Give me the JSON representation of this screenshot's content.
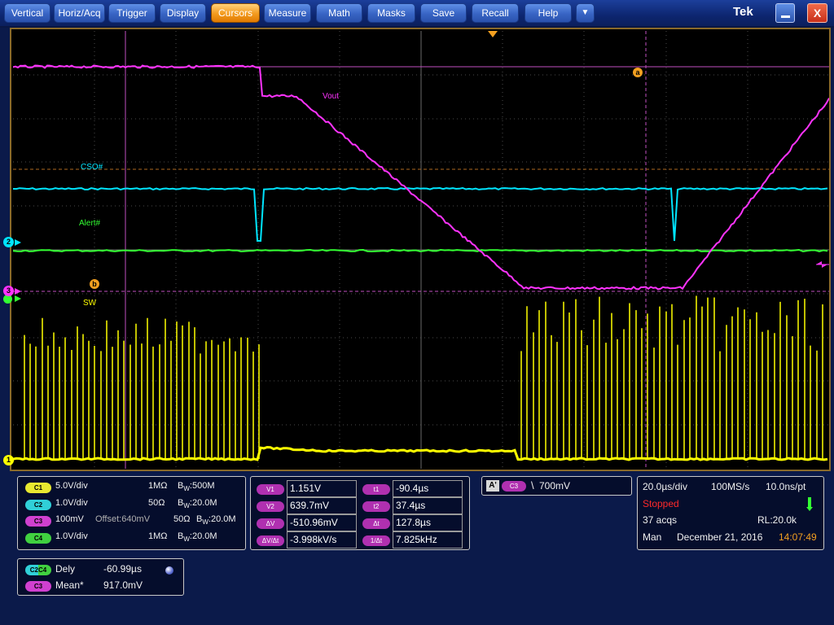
{
  "menu": {
    "items": [
      {
        "label": "Vertical",
        "active": false
      },
      {
        "label": "Horiz/Acq",
        "active": false
      },
      {
        "label": "Trigger",
        "active": false
      },
      {
        "label": "Display",
        "active": false
      },
      {
        "label": "Cursors",
        "active": true
      },
      {
        "label": "Measure",
        "active": false
      },
      {
        "label": "Math",
        "active": false
      },
      {
        "label": "Masks",
        "active": false
      },
      {
        "label": "Save",
        "active": false
      },
      {
        "label": "Recall",
        "active": false
      },
      {
        "label": "Help",
        "active": false
      }
    ],
    "more_glyph": "▼",
    "brand": "Tek",
    "minimize_glyph": "_",
    "close_glyph": "X"
  },
  "scope": {
    "trace_labels": {
      "vout": "Vout",
      "cso": "CSO#",
      "alert": "Alert#",
      "sw": "SW"
    },
    "channel_markers": {
      "c2": "2",
      "c3": "3",
      "c1": "1"
    },
    "cursor_tags": {
      "a": "a",
      "b": "b"
    },
    "colors": {
      "ch1": "#ffff00",
      "ch2": "#00e5ff",
      "ch3": "#ff33ff",
      "ch4": "#33ff33",
      "grid": "#555555",
      "cursor": "#f3a020"
    }
  },
  "channels": {
    "c1": {
      "tag": "C1",
      "scale": "5.0V/div",
      "impedance": "1MΩ",
      "bw_prefix": "B",
      "bw_sub": "W",
      "bw": ":500M"
    },
    "c2": {
      "tag": "C2",
      "scale": "1.0V/div",
      "impedance": "50Ω",
      "bw_prefix": "B",
      "bw_sub": "W",
      "bw": ":20.0M"
    },
    "c3": {
      "tag": "C3",
      "scale": "100mV",
      "offset": "Offset:640mV",
      "impedance": "50Ω",
      "bw_prefix": "B",
      "bw_sub": "W",
      "bw": ":20.0M"
    },
    "c4": {
      "tag": "C4",
      "scale": "1.0V/div",
      "impedance": "1MΩ",
      "bw_prefix": "B",
      "bw_sub": "W",
      "bw": ":20.0M"
    }
  },
  "cursors": {
    "v1": {
      "label": "V1",
      "value": "1.151V"
    },
    "v2": {
      "label": "V2",
      "value": "639.7mV"
    },
    "dv": {
      "label": "ΔV",
      "value": "-510.96mV"
    },
    "dvdt": {
      "label": "ΔV/Δt",
      "value": "-3.998kV/s"
    },
    "t1": {
      "label": "t1",
      "value": "-90.4µs"
    },
    "t2": {
      "label": "t2",
      "value": "37.4µs"
    },
    "dt": {
      "label": "Δt",
      "value": "127.8µs"
    },
    "inv_dt": {
      "label": "1/Δt",
      "value": "7.825kHz"
    }
  },
  "trigger": {
    "mode": "A'",
    "source": "C3",
    "slope_glyph": "\\",
    "level": "700mV"
  },
  "acquisition": {
    "timebase": "20.0µs/div",
    "sample_rate": "100MS/s",
    "resolution": "10.0ns/pt",
    "state": "Stopped",
    "acqs": "37 acqs",
    "record_length": "RL:20.0k",
    "mode": "Man",
    "date": "December 21, 2016",
    "time": "14:07:49"
  },
  "measurements": {
    "m1": {
      "source": "C2C4",
      "name": "Dely",
      "value": "-60.99µs"
    },
    "m2": {
      "source": "C3",
      "name": "Mean*",
      "value": "917.0mV"
    }
  }
}
